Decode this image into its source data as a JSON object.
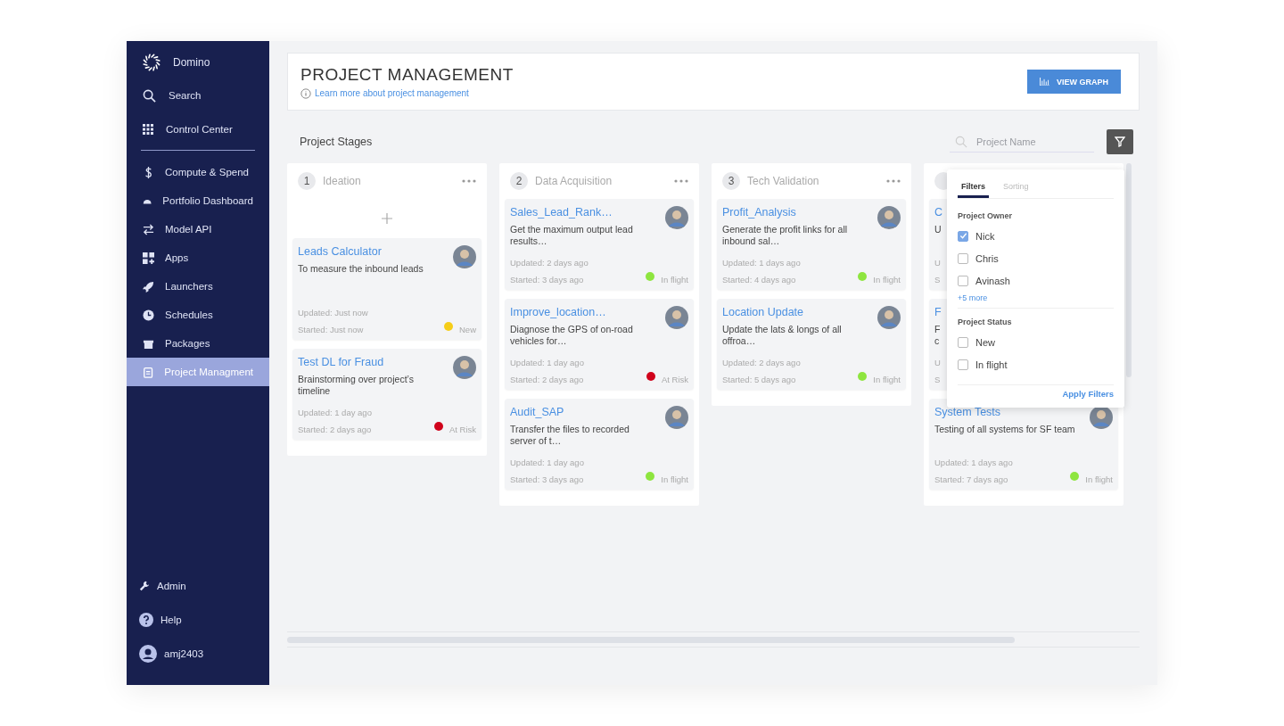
{
  "sidebar": {
    "brand": "Domino",
    "top_items": [
      {
        "kind": "search",
        "label": "Search"
      },
      {
        "kind": "grid",
        "label": "Control Center"
      }
    ],
    "items": [
      {
        "kind": "dollar",
        "label": "Compute & Spend",
        "selected": false
      },
      {
        "kind": "gauge",
        "label": "Portfolio Dashboard",
        "selected": false
      },
      {
        "kind": "arrows",
        "label": "Model API",
        "selected": false
      },
      {
        "kind": "apps",
        "label": "Apps",
        "selected": false
      },
      {
        "kind": "rocket",
        "label": "Launchers",
        "selected": false
      },
      {
        "kind": "clock",
        "label": "Schedules",
        "selected": false
      },
      {
        "kind": "package",
        "label": "Packages",
        "selected": false
      },
      {
        "kind": "clipboard",
        "label": "Project Managment",
        "selected": true
      }
    ],
    "bottom_items": [
      {
        "kind": "wrench",
        "label": "Admin"
      },
      {
        "kind": "help",
        "label": "Help"
      },
      {
        "kind": "user",
        "label": "amj2403"
      }
    ]
  },
  "header": {
    "title": "PROJECT MANAGEMENT",
    "link": "Learn more about project management",
    "button": "VIEW GRAPH"
  },
  "toolbar": {
    "title": "Project Stages",
    "search": {
      "placeholder": "Project Name"
    }
  },
  "stages": [
    {
      "number": "1",
      "name": "Ideation",
      "can_add": true,
      "cards": [
        {
          "title": "Leads Calculator",
          "description": "To measure the inbound leads",
          "updated": "Updated: Just now",
          "started": "Started: Just now",
          "status": "New",
          "color": "#f5cd19"
        },
        {
          "title": "Test DL for Fraud",
          "description": "Brainstorming over project’s timeline",
          "updated": "Updated: 1 day ago",
          "started": "Started: 2 days ago",
          "status": "At Risk",
          "color": "#d0021b"
        }
      ]
    },
    {
      "number": "2",
      "name": "Data Acquisition",
      "can_add": false,
      "cards": [
        {
          "title": "Sales_Lead_Rank…",
          "description": "Get the maximum output lead results…",
          "updated": "Updated: 2 days ago",
          "started": "Started: 3 days ago",
          "status": "In flight",
          "color": "#8ee53f"
        },
        {
          "title": "Improve_location…",
          "description": "Diagnose the GPS of on-road vehicles for…",
          "updated": "Updated: 1 day ago",
          "started": "Started: 2 days ago",
          "status": "At Risk",
          "color": "#d0021b"
        },
        {
          "title": "Audit_SAP",
          "description": "Transfer the files to recorded server of t…",
          "updated": "Updated: 1 day ago",
          "started": "Started: 3 days ago",
          "status": "In flight",
          "color": "#8ee53f"
        }
      ]
    },
    {
      "number": "3",
      "name": "Tech Validation",
      "can_add": false,
      "cards": [
        {
          "title": "Profit_Analysis",
          "description": "Generate the profit links for all inbound sal…",
          "updated": "Updated: 1 days ago",
          "started": "Started: 4 days ago",
          "status": "In flight",
          "color": "#8ee53f"
        },
        {
          "title": "Location Update",
          "description": "Update the lats & longs of all offroa…",
          "updated": "Updated: 2 days ago",
          "started": "Started: 5 days ago",
          "status": "In flight",
          "color": "#8ee53f"
        }
      ]
    },
    {
      "can_add": false,
      "cards": [
        {
          "title": "C",
          "description": "U",
          "updated": "U",
          "started": "S"
        },
        {
          "title": "F",
          "description": "F\nc",
          "updated": "U",
          "started": "S"
        },
        {
          "title": "System Tests",
          "description": "Testing of all systems for SF team",
          "updated": "Updated: 1 days ago",
          "started": "Started: 7 days ago",
          "status": "In flight",
          "color": "#8ee53f"
        }
      ]
    }
  ],
  "filter_popover": {
    "tabs": [
      {
        "label": "Filters",
        "selected": true
      },
      {
        "label": "Sorting",
        "selected": false
      }
    ],
    "owner": {
      "title": "Project Owner",
      "options": [
        {
          "label": "Nick",
          "checked": true
        },
        {
          "label": "Chris",
          "checked": false
        },
        {
          "label": "Avinash",
          "checked": false
        }
      ],
      "more": "+5 more"
    },
    "status": {
      "title": "Project Status",
      "options": [
        {
          "label": "New",
          "checked": false
        },
        {
          "label": "In flight",
          "checked": false
        }
      ]
    },
    "apply": "Apply Filters"
  }
}
